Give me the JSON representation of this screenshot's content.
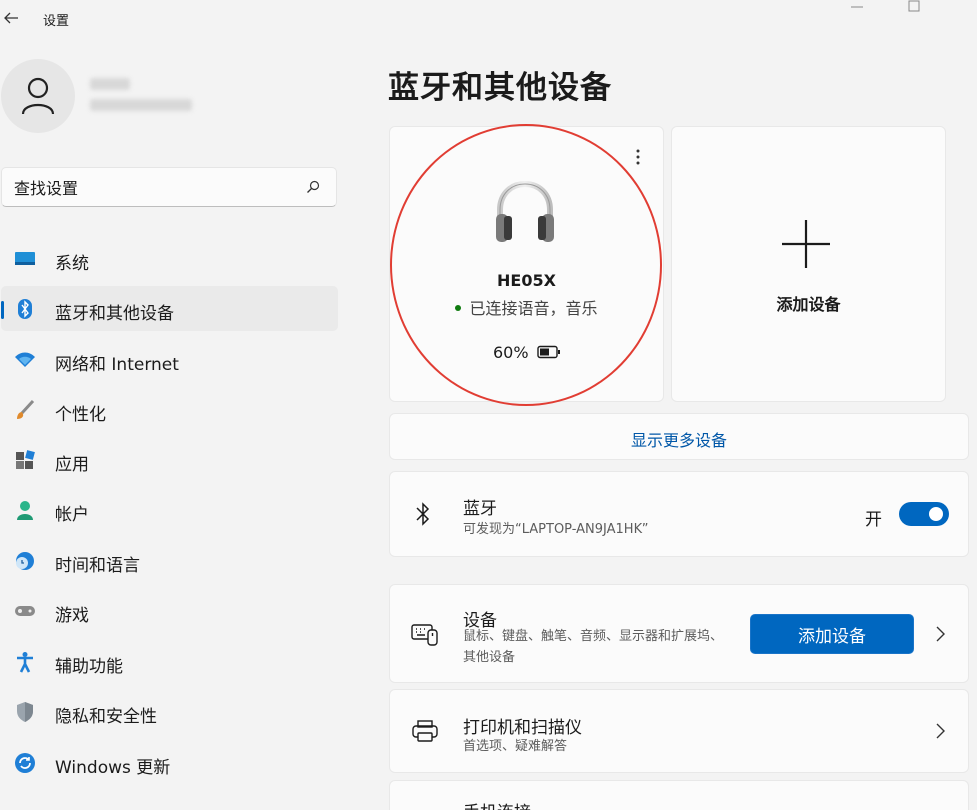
{
  "window": {
    "title": "设置"
  },
  "search": {
    "placeholder": "查找设置"
  },
  "sidebar": {
    "items": [
      {
        "label": "系统"
      },
      {
        "label": "蓝牙和其他设备"
      },
      {
        "label": "网络和 Internet"
      },
      {
        "label": "个性化"
      },
      {
        "label": "应用"
      },
      {
        "label": "帐户"
      },
      {
        "label": "时间和语言"
      },
      {
        "label": "游戏"
      },
      {
        "label": "辅助功能"
      },
      {
        "label": "隐私和安全性"
      },
      {
        "label": "Windows 更新"
      }
    ]
  },
  "main": {
    "title": "蓝牙和其他设备",
    "device": {
      "name": "HE05X",
      "status": "已连接语音，音乐",
      "battery": "60%",
      "battery_level": 0.6
    },
    "add_card": {
      "label": "添加设备"
    },
    "show_more": "显示更多设备",
    "bluetooth": {
      "title": "蓝牙",
      "subtitle": "可发现为“LAPTOP-AN9JA1HK”",
      "toggle_label": "开",
      "on": true
    },
    "devices_row": {
      "title": "设备",
      "subtitle": "鼠标、键盘、触笔、音频、显示器和扩展坞、其他设备",
      "button": "添加设备"
    },
    "printers_row": {
      "title": "打印机和扫描仪",
      "subtitle": "首选项、疑难解答"
    },
    "phone_row": {
      "title": "手机连接"
    }
  },
  "colors": {
    "accent": "#0067c0",
    "annotation": "#e13d33",
    "status_green": "#0f7b0f"
  }
}
